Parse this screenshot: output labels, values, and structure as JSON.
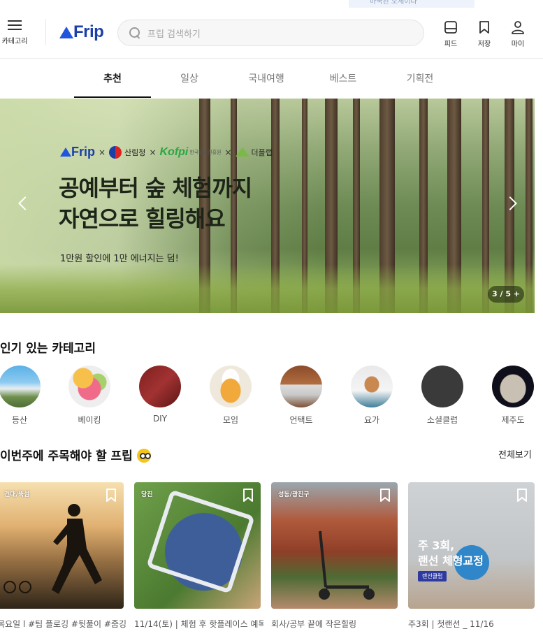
{
  "header": {
    "ghost_tooltip": "마국된 오세이나",
    "category_label": "카테고리",
    "logo_text": "Frip",
    "search_placeholder": "프립 검색하기",
    "icons": [
      {
        "name": "feed-icon",
        "label": "피드"
      },
      {
        "name": "bookmark-icon",
        "label": "저장"
      },
      {
        "name": "user-icon",
        "label": "마이"
      }
    ]
  },
  "tabs": [
    {
      "label": "추천",
      "active": true
    },
    {
      "label": "일상",
      "active": false
    },
    {
      "label": "국내여행",
      "active": false
    },
    {
      "label": "베스트",
      "active": false
    },
    {
      "label": "기획전",
      "active": false
    }
  ],
  "banner": {
    "partners": {
      "frip": "Frip",
      "x": "×",
      "forest_service": "산림청",
      "kofpi": "Kofpi",
      "kofpi_sub": "한국임업진흥원",
      "dpl": "더플랩"
    },
    "title_line1": "공예부터 숲 체험까지",
    "title_line2": "자연으로 힐링해요",
    "subtitle": "1만원 할인에 1만 에너지는 덤!",
    "pager": "3 / 5 +"
  },
  "popular_categories": {
    "title": "인기 있는 카테고리",
    "items": [
      {
        "label": "등산",
        "icon": "mountain-icon"
      },
      {
        "label": "베이킹",
        "icon": "macaron-icon"
      },
      {
        "label": "DIY",
        "icon": "wallet-icon"
      },
      {
        "label": "모임",
        "icon": "beer-icon"
      },
      {
        "label": "언택트",
        "icon": "laptop-icon"
      },
      {
        "label": "요가",
        "icon": "yoga-icon"
      },
      {
        "label": "소셜클럽",
        "icon": "social-club-icon"
      },
      {
        "label": "제주도",
        "icon": "dol-hareubang-icon"
      }
    ]
  },
  "weekly": {
    "title": "이번주에 주목해야 할 프립",
    "see_all": "전체보기",
    "cards": [
      {
        "location": "건대/뚝섬",
        "title": "목요일 l #팀 플로깅 #뒷풀이 #줍깅"
      },
      {
        "location": "당진",
        "title": "11/14(토) | 체험 후 핫플레이스 예목"
      },
      {
        "location": "성동/광진구",
        "title": "회사/공부 끝에 작은힐링"
      },
      {
        "location": "",
        "title": "주3회 | 첫랜선 _ 11/16",
        "overlay_line1": "주 3회,",
        "overlay_line2": "랜선 체형교정",
        "badge": "랜선클럽"
      }
    ]
  },
  "colors": {
    "brand": "#1a3fa8",
    "accent": "#2255dd"
  }
}
